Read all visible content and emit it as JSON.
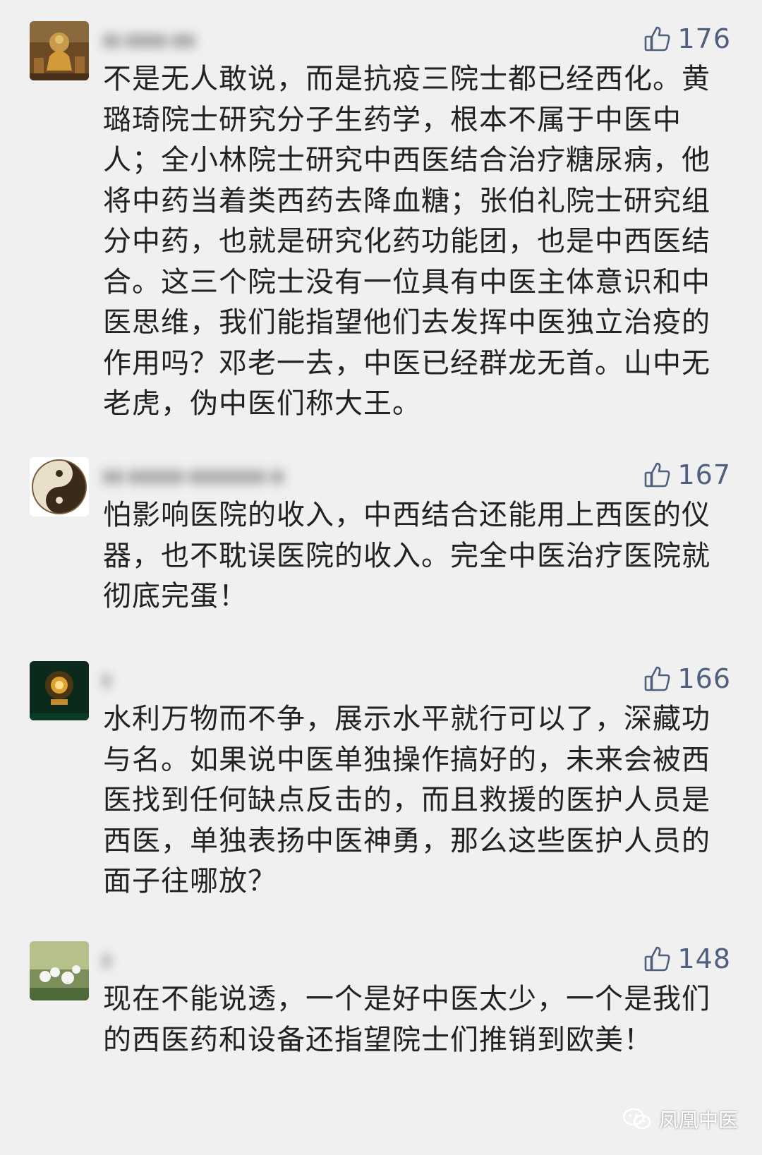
{
  "comments": [
    {
      "likes": "176",
      "text": "不是无人敢说，而是抗疫三院士都已经西化。黄璐琦院士研究分子生药学，根本不属于中医中人；全小林院士研究中西医结合治疗糖尿病，他将中药当着类西药去降血糖；张伯礼院士研究组分中药，也就是研究化药功能团，也是中西医结合。这三个院士没有一位具有中医主体意识和中医思维，我们能指望他们去发挥中医独立治疫的作用吗？邓老一去，中医已经群龙无首。山中无老虎，伪中医们称大王。"
    },
    {
      "likes": "167",
      "text": "怕影响医院的收入，中西结合还能用上西医的仪器，也不耽误医院的收入。完全中医治疗医院就彻底完蛋！"
    },
    {
      "likes": "166",
      "text": "水利万物而不争，展示水平就行可以了，深藏功与名。如果说中医单独操作搞好的，未来会被西医找到任何缺点反击的，而且救援的医护人员是西医，单独表扬中医神勇，那么这些医护人员的面子往哪放？"
    },
    {
      "likes": "148",
      "text": "现在不能说透，一个是好中医太少，一个是我们的西医药和设备还指望院士们推销到欧美！"
    }
  ],
  "watermark": {
    "label": "凤凰中医",
    "icon": "wechat-icon"
  },
  "colors": {
    "background": "#f0f0f0",
    "text": "#222222",
    "like": "#4f5f7e"
  },
  "icons": {
    "like": "thumbs-up-icon"
  }
}
